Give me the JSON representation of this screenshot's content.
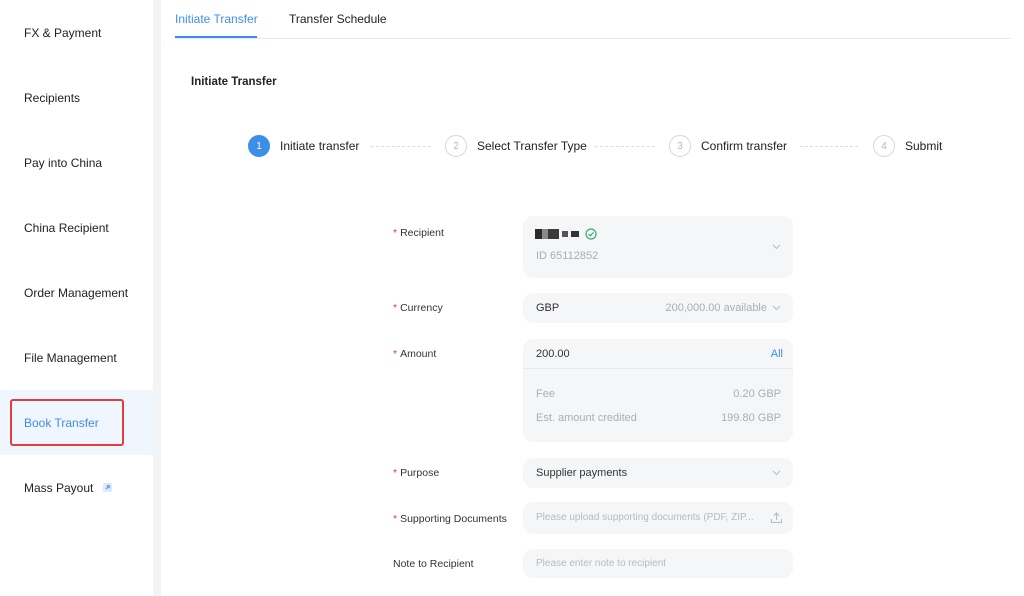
{
  "sidebar": {
    "items": [
      {
        "label": "FX & Payment"
      },
      {
        "label": "Recipients"
      },
      {
        "label": "Pay into China"
      },
      {
        "label": "China Recipient"
      },
      {
        "label": "Order Management"
      },
      {
        "label": "File Management"
      },
      {
        "label": "Book Transfer"
      },
      {
        "label": "Mass Payout"
      }
    ],
    "active_index": 6
  },
  "tabs": [
    {
      "label": "Initiate Transfer"
    },
    {
      "label": "Transfer Schedule"
    }
  ],
  "section_title": "Initiate Transfer",
  "steps": [
    {
      "number": "1",
      "label": "Initiate transfer"
    },
    {
      "number": "2",
      "label": "Select Transfer Type"
    },
    {
      "number": "3",
      "label": "Confirm transfer"
    },
    {
      "number": "4",
      "label": "Submit"
    }
  ],
  "form": {
    "recipient": {
      "label": "Recipient",
      "id_text": "ID 65112852"
    },
    "currency": {
      "label": "Currency",
      "value": "GBP",
      "available": "200,000.00 available"
    },
    "amount": {
      "label": "Amount",
      "value": "200.00",
      "all_label": "All",
      "fee_label": "Fee",
      "fee_value": "0.20 GBP",
      "est_label": "Est. amount credited",
      "est_value": "199.80 GBP"
    },
    "purpose": {
      "label": "Purpose",
      "value": "Supplier payments"
    },
    "docs": {
      "label": "Supporting Documents",
      "placeholder": "Please upload supporting documents (PDF, ZIP..."
    },
    "note": {
      "label": "Note to Recipient",
      "placeholder": "Please enter note to recipient"
    }
  },
  "colors": {
    "accent": "#3d8ee8",
    "required": "#e23c3c",
    "success": "#3ea872"
  }
}
